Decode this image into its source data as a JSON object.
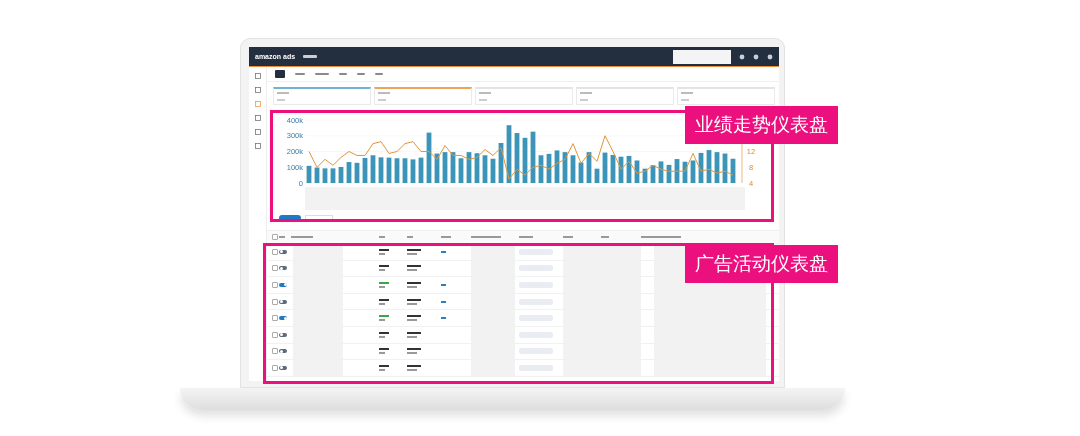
{
  "header": {
    "brand": "amazon ads"
  },
  "metric_cards": [
    {
      "color": "#6fb3d2"
    },
    {
      "color": "#eaa55a"
    },
    {
      "color": "#e4e4e4"
    },
    {
      "color": "#e4e4e4"
    },
    {
      "color": "#e4e4e4"
    }
  ],
  "chart": {
    "chart_data": {
      "type": "bar",
      "ylim": [
        0,
        400000
      ],
      "yticks": [
        {
          "value": 0,
          "label": "0"
        },
        {
          "value": 100000,
          "label": "100k"
        },
        {
          "value": 200000,
          "label": "200k"
        },
        {
          "value": 300000,
          "label": "300k"
        },
        {
          "value": 400000,
          "label": "400k"
        }
      ],
      "y2lim": [
        4,
        20
      ],
      "y2ticks": [
        4,
        8,
        12
      ],
      "series": [
        {
          "color": "#3c94b9",
          "values": [
            109000,
            98000,
            93000,
            93000,
            102000,
            133000,
            128000,
            159000,
            176000,
            163000,
            161000,
            157000,
            157000,
            150000,
            161000,
            320000,
            187000,
            196000,
            196000,
            157000,
            196000,
            189000,
            176000,
            154000,
            254000,
            367000,
            317000,
            287000,
            326000,
            176000,
            185000,
            207000,
            196000,
            176000,
            130000,
            196000,
            91000,
            193000,
            178000,
            167000,
            172000,
            143000,
            91000,
            113000,
            137000,
            115000,
            152000,
            135000,
            143000,
            191000,
            209000,
            196000,
            187000,
            154000
          ]
        },
        {
          "type": "line",
          "axis": "y2",
          "color": "#e0963a",
          "values": [
            12,
            8,
            10,
            8.5,
            10.5,
            12,
            11,
            11,
            14,
            14.5,
            11.5,
            12,
            14,
            14.5,
            12,
            12,
            10,
            13.5,
            11,
            11,
            10,
            10.5,
            12.5,
            11,
            13,
            5,
            7.5,
            6,
            8,
            8.5,
            7.5,
            9,
            10,
            14,
            9,
            11.5,
            9.5,
            16,
            12,
            7.5,
            9.5,
            6.5,
            7,
            8.5,
            7.5,
            7,
            7,
            7,
            11.5,
            7,
            7.5,
            6.5,
            7,
            6
          ]
        }
      ]
    }
  },
  "table_header": {
    "checked": false
  },
  "campaign_rows": [
    {
      "checked": false,
      "on": false,
      "has_link": true
    },
    {
      "checked": false,
      "on": false,
      "has_link": false
    },
    {
      "checked": false,
      "on": true,
      "has_link": true
    },
    {
      "checked": false,
      "on": false,
      "has_link": true
    },
    {
      "checked": false,
      "on": true,
      "has_link": true
    },
    {
      "checked": false,
      "on": false,
      "has_link": false
    },
    {
      "checked": false,
      "on": false,
      "has_link": false
    },
    {
      "checked": false,
      "on": false,
      "has_link": false
    }
  ],
  "callouts": [
    {
      "label": "业绩走势仪表盘"
    },
    {
      "label": "广告活动仪表盘"
    }
  ]
}
